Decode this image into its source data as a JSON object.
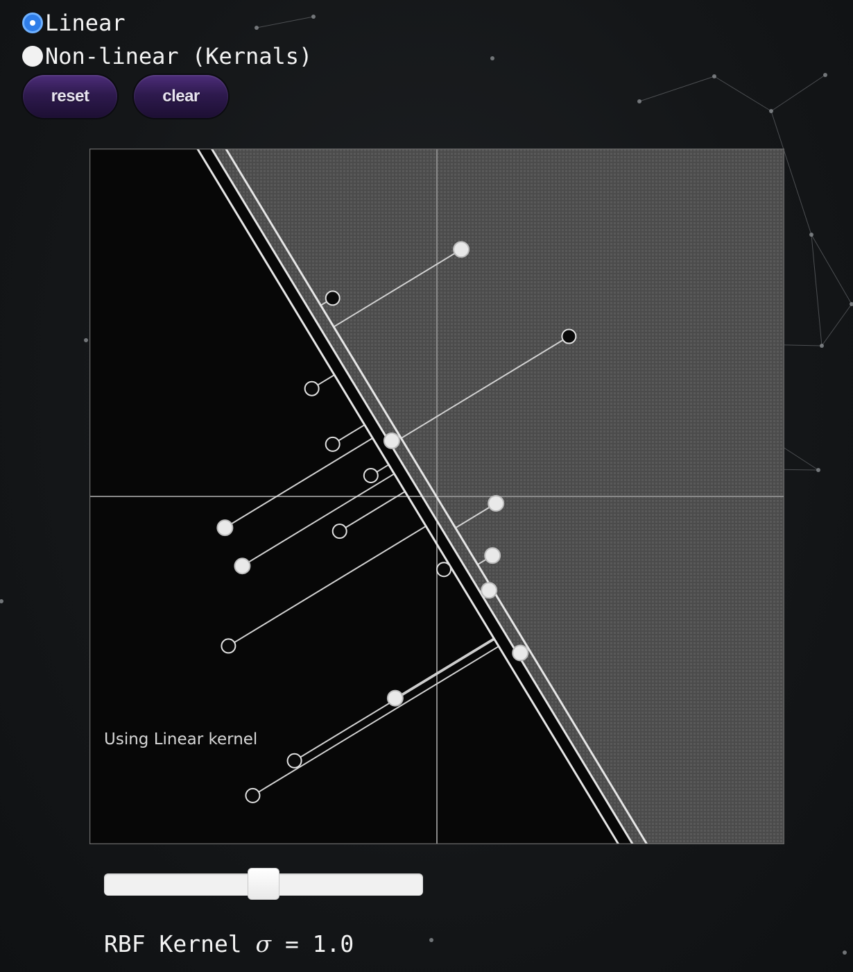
{
  "controls": {
    "mode_options": [
      {
        "label": "Linear",
        "checked": true
      },
      {
        "label": "Non-linear (Kernals)",
        "checked": false
      }
    ],
    "reset_label": "reset",
    "clear_label": "clear"
  },
  "plot": {
    "caption": "Using Linear kernel",
    "decision_boundary": {
      "slope": -1.65,
      "intercept": -0.07,
      "margin": 0.035
    },
    "points": [
      {
        "x": 0.07,
        "y": 0.71,
        "label": "white"
      },
      {
        "x": -0.3,
        "y": 0.57,
        "label": "black"
      },
      {
        "x": 0.38,
        "y": 0.46,
        "label": "black"
      },
      {
        "x": -0.36,
        "y": 0.31,
        "label": "black"
      },
      {
        "x": -0.3,
        "y": 0.15,
        "label": "black"
      },
      {
        "x": -0.13,
        "y": 0.16,
        "label": "white"
      },
      {
        "x": -0.19,
        "y": 0.06,
        "label": "black"
      },
      {
        "x": -0.61,
        "y": -0.09,
        "label": "white"
      },
      {
        "x": 0.17,
        "y": -0.02,
        "label": "white"
      },
      {
        "x": -0.28,
        "y": -0.1,
        "label": "black"
      },
      {
        "x": -0.56,
        "y": -0.2,
        "label": "white"
      },
      {
        "x": 0.16,
        "y": -0.17,
        "label": "white"
      },
      {
        "x": 0.02,
        "y": -0.21,
        "label": "black"
      },
      {
        "x": 0.15,
        "y": -0.27,
        "label": "white"
      },
      {
        "x": 0.24,
        "y": -0.45,
        "label": "white"
      },
      {
        "x": -0.6,
        "y": -0.43,
        "label": "black"
      },
      {
        "x": -0.12,
        "y": -0.58,
        "label": "white"
      },
      {
        "x": -0.41,
        "y": -0.76,
        "label": "black"
      },
      {
        "x": -0.53,
        "y": -0.86,
        "label": "black"
      }
    ]
  },
  "sigma_slider": {
    "value": 0.5
  },
  "sigma": {
    "prefix": "RBF Kernel ",
    "symbol": "σ",
    "suffix": " = 1.0"
  }
}
